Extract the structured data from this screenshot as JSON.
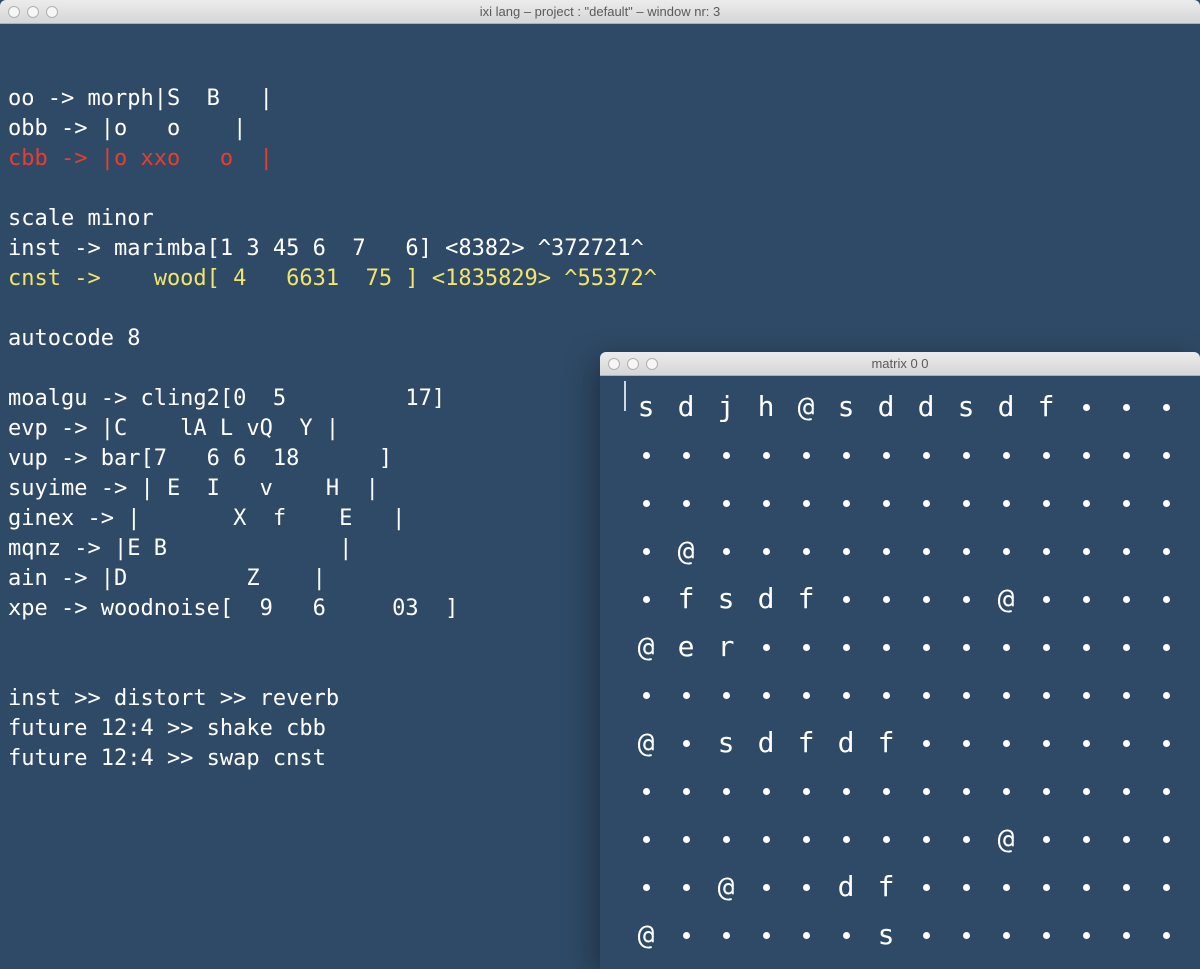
{
  "main": {
    "title": "ixi lang   –   project : \"default\"   –   window nr: 3",
    "lines": [
      {
        "text": "oo -> morph|S  B   |",
        "cls": ""
      },
      {
        "text": "obb -> |o   o    |",
        "cls": ""
      },
      {
        "text": "cbb -> |o xxo   o  |",
        "cls": "red"
      },
      {
        "text": "",
        "cls": ""
      },
      {
        "text": "scale minor",
        "cls": ""
      },
      {
        "text": "inst -> marimba[1 3 45 6  7   6] <8382> ^372721^",
        "cls": ""
      },
      {
        "text": "cnst ->    wood[ 4   6631  75 ] <1835829> ^55372^",
        "cls": "yellow"
      },
      {
        "text": "",
        "cls": ""
      },
      {
        "text": "autocode 8",
        "cls": ""
      },
      {
        "text": "",
        "cls": ""
      },
      {
        "text": "moalgu -> cling2[0  5         17]",
        "cls": ""
      },
      {
        "text": "evp -> |C    lA L vQ  Y |",
        "cls": ""
      },
      {
        "text": "vup -> bar[7   6 6  18      ]",
        "cls": ""
      },
      {
        "text": "suyime -> | E  I   v    H  |",
        "cls": ""
      },
      {
        "text": "ginex -> |       X  f    E   |",
        "cls": ""
      },
      {
        "text": "mqnz -> |E B             |",
        "cls": ""
      },
      {
        "text": "ain -> |D         Z    |",
        "cls": ""
      },
      {
        "text": "xpe -> woodnoise[  9   6     03  ]",
        "cls": ""
      },
      {
        "text": "",
        "cls": ""
      },
      {
        "text": "",
        "cls": ""
      },
      {
        "text": "inst >> distort >> reverb",
        "cls": ""
      },
      {
        "text": "future 12:4 >> shake cbb",
        "cls": ""
      },
      {
        "text": "future 12:4 >> swap cnst",
        "cls": ""
      }
    ]
  },
  "matrix": {
    "title": "matrix 0 0",
    "rows": [
      [
        "s",
        "d",
        "j",
        "h",
        "@",
        "s",
        "d",
        "d",
        "s",
        "d",
        "f",
        ".",
        ".",
        "."
      ],
      [
        ".",
        ".",
        ".",
        ".",
        ".",
        ".",
        ".",
        ".",
        ".",
        ".",
        ".",
        ".",
        ".",
        "."
      ],
      [
        ".",
        ".",
        ".",
        ".",
        ".",
        ".",
        ".",
        ".",
        ".",
        ".",
        ".",
        ".",
        ".",
        "."
      ],
      [
        ".",
        "@",
        ".",
        ".",
        ".",
        ".",
        ".",
        ".",
        ".",
        ".",
        ".",
        ".",
        ".",
        "."
      ],
      [
        ".",
        "f",
        "s",
        "d",
        "f",
        ".",
        ".",
        ".",
        ".",
        "@",
        ".",
        ".",
        ".",
        "."
      ],
      [
        "@",
        "e",
        "r",
        ".",
        ".",
        ".",
        ".",
        ".",
        ".",
        ".",
        ".",
        ".",
        ".",
        "."
      ],
      [
        ".",
        ".",
        ".",
        ".",
        ".",
        ".",
        ".",
        ".",
        ".",
        ".",
        ".",
        ".",
        ".",
        "."
      ],
      [
        "@",
        ".",
        "s",
        "d",
        "f",
        "d",
        "f",
        ".",
        ".",
        ".",
        ".",
        ".",
        ".",
        "."
      ],
      [
        ".",
        ".",
        ".",
        ".",
        ".",
        ".",
        ".",
        ".",
        ".",
        ".",
        ".",
        ".",
        ".",
        "."
      ],
      [
        ".",
        ".",
        ".",
        ".",
        ".",
        ".",
        ".",
        ".",
        ".",
        "@",
        ".",
        ".",
        ".",
        "."
      ],
      [
        ".",
        ".",
        "@",
        ".",
        ".",
        "d",
        "f",
        ".",
        ".",
        ".",
        ".",
        ".",
        ".",
        "."
      ],
      [
        "@",
        ".",
        ".",
        ".",
        ".",
        ".",
        "s",
        ".",
        ".",
        ".",
        ".",
        ".",
        ".",
        "."
      ]
    ]
  }
}
